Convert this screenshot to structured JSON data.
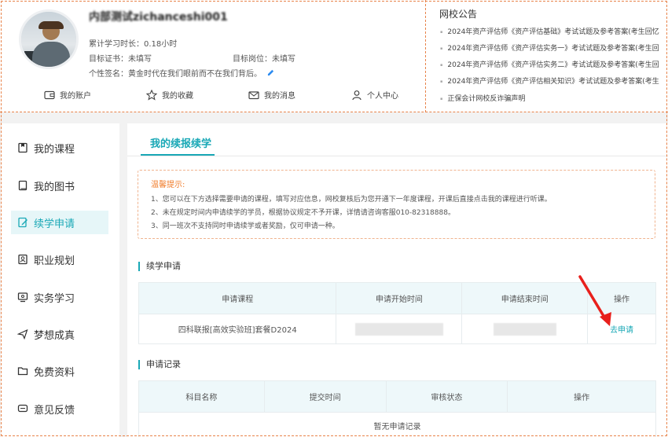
{
  "header": {
    "username": "内部测试zichanceshi001",
    "study_time_label": "累计学习时长：",
    "study_time_value": "0.18小时",
    "cert_label": "目标证书：",
    "cert_value": "未填写",
    "job_label": "目标岗位：",
    "job_value": "未填写",
    "signature_label": "个性签名：",
    "signature_value": "黄金时代在我们眼前而不在我们背后。"
  },
  "quick_links": [
    {
      "label": "我的账户",
      "icon": "wallet-icon"
    },
    {
      "label": "我的收藏",
      "icon": "star-icon"
    },
    {
      "label": "我的消息",
      "icon": "mail-icon"
    },
    {
      "label": "个人中心",
      "icon": "user-icon"
    }
  ],
  "notice": {
    "title": "网校公告",
    "items": [
      "2024年资产评估师《资产评估基础》考试试题及参考答案(考生回忆",
      "2024年资产评估师《资产评估实务一》考试试题及参考答案(考生回",
      "2024年资产评估师《资产评估实务二》考试试题及参考答案(考生回",
      "2024年资产评估师《资产评估相关知识》考试试题及参考答案(考生",
      "正保会计网校反诈骗声明"
    ]
  },
  "sidebar": {
    "items": [
      {
        "label": "我的课程",
        "icon": "course-icon",
        "active": false
      },
      {
        "label": "我的图书",
        "icon": "book-icon",
        "active": false
      },
      {
        "label": "续学申请",
        "icon": "edit-doc-icon",
        "active": true
      },
      {
        "label": "职业规划",
        "icon": "career-icon",
        "active": false
      },
      {
        "label": "实务学习",
        "icon": "monitor-icon",
        "active": false
      },
      {
        "label": "梦想成真",
        "icon": "send-icon",
        "active": false
      },
      {
        "label": "免费资料",
        "icon": "folder-icon",
        "active": false
      },
      {
        "label": "意见反馈",
        "icon": "feedback-icon",
        "active": false
      }
    ]
  },
  "main": {
    "tab_title": "我的续报续学",
    "tip": {
      "title": "温馨提示:",
      "lines": [
        "1、您可以在下方选择需要申请的课程，填写对应信息，网校复核后为您开通下一年度课程，开课后直接点击我的课程进行听课。",
        "2、未在规定时间内申请续学的学员，根据协议规定不予开课，详情请咨询客服010-82318888。",
        "3、同一班次不支持同时申请续学或者奖励，仅可申请一种。"
      ]
    },
    "apply_section": {
      "title": "续学申请",
      "headers": [
        "申请课程",
        "申请开始时间",
        "申请结束时间",
        "操作"
      ],
      "rows": [
        {
          "course": "四科联报[高效实验班]套餐D2024",
          "start": "",
          "end": "",
          "action": "去申请"
        }
      ]
    },
    "record_section": {
      "title": "申请记录",
      "headers": [
        "科目名称",
        "提交时间",
        "审核状态",
        "操作"
      ],
      "empty_text": "暂无申请记录"
    }
  }
}
